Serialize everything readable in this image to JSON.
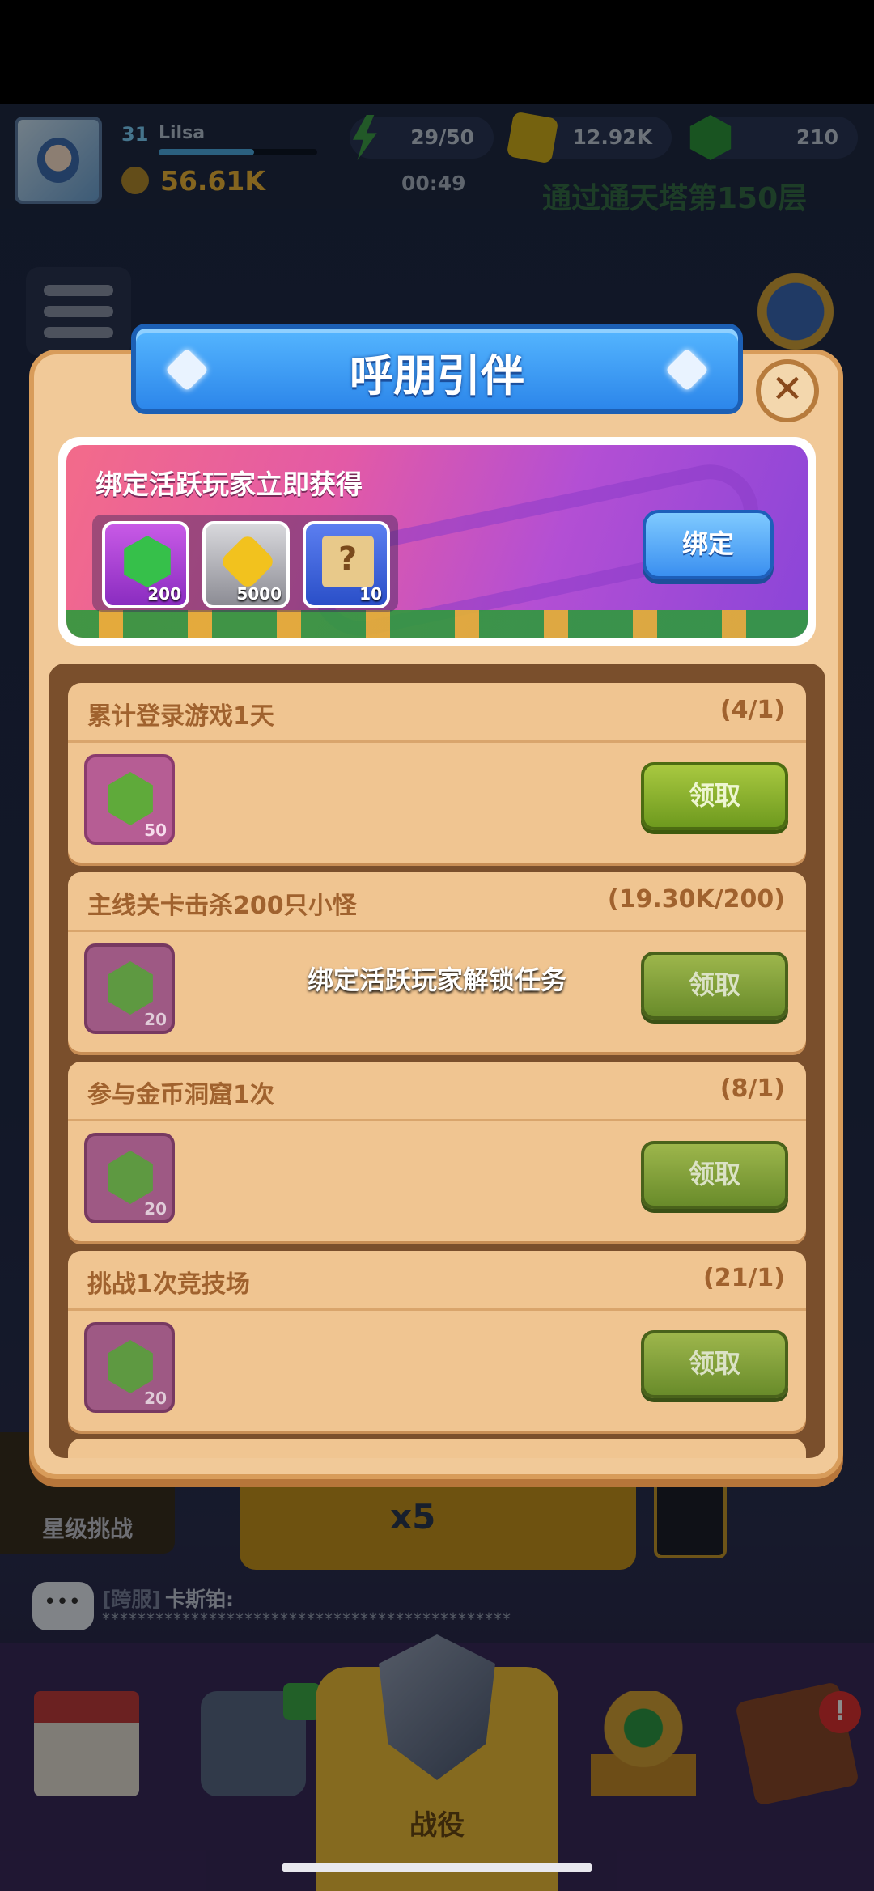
{
  "hud": {
    "level": "31",
    "player_name": "Lilsa",
    "power": "56.61K",
    "energy": "29/50",
    "energy_timer": "00:49",
    "coins": "12.92K",
    "gems": "210",
    "quest_hint": "通过通天塔第150层"
  },
  "modal": {
    "title": "呼朋引伴",
    "close_icon": "close-icon",
    "bind_banner": {
      "headline": "绑定活跃玩家立即获得",
      "rewards": [
        {
          "icon": "green-gem-icon",
          "amount": "200"
        },
        {
          "icon": "gold-coin-icon",
          "amount": "5000"
        },
        {
          "icon": "mystery-scroll-icon",
          "amount": "10"
        }
      ],
      "button_label": "绑定"
    },
    "lock_note": "绑定活跃玩家解锁任务",
    "tasks": [
      {
        "title": "累计登录游戏1天",
        "progress": "(4/1)",
        "reward_amount": "50",
        "button_label": "领取"
      },
      {
        "title": "主线关卡击杀200只小怪",
        "progress": "(19.30K/200)",
        "reward_amount": "20",
        "button_label": "领取"
      },
      {
        "title": "参与金币洞窟1次",
        "progress": "(8/1)",
        "reward_amount": "20",
        "button_label": "领取"
      },
      {
        "title": "挑战1次竞技场",
        "progress": "(21/1)",
        "reward_amount": "20",
        "button_label": "领取"
      }
    ]
  },
  "background": {
    "star_challenge_label": "星级挑战",
    "multiplier": "x5",
    "chat": {
      "channel": "[跨服]",
      "sender": "卡斯铂:",
      "message": "**********************************************"
    },
    "nav": {
      "battle_label": "战役",
      "gift_badge": "!"
    }
  },
  "colors": {
    "modal_bg": "#f1c998",
    "title_blue": "#2c86ea",
    "claim_green": "#6e9a1e",
    "task_text": "#a0622e"
  }
}
